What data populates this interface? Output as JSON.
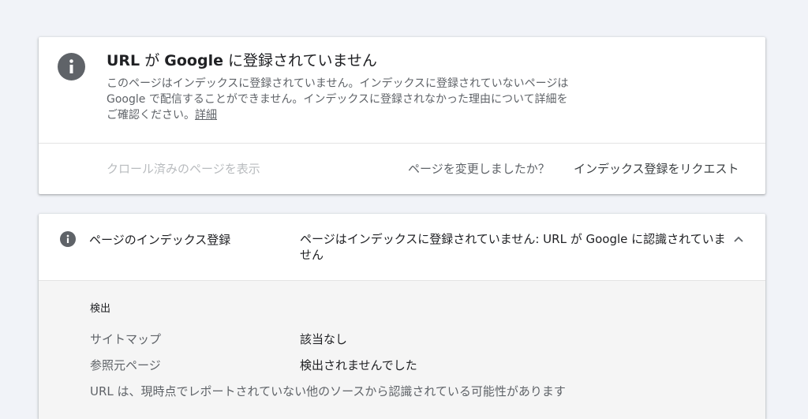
{
  "status_card": {
    "icon": "info-icon",
    "title": {
      "url": "URL",
      "ga": " が ",
      "google": "Google",
      "rest": " に登録されていません"
    },
    "description": "このページはインデックスに登録されていません。インデックスに登録されていないページは Google で配信することができません。インデックスに登録されなかった理由について詳細をご確認ください。",
    "details_link": "詳細",
    "crawl_link": "クロール済みのページを表示",
    "question": "ページを変更しましたか？",
    "request_button": "インデックス登録をリクエスト"
  },
  "coverage_card": {
    "icon": "info-icon",
    "label": "ページのインデックス登録",
    "status": "ページはインデックスに登録されていません: URL が Google に認識されていません",
    "expanded": true,
    "section_title": "検出",
    "rows": [
      {
        "label": "サイトマップ",
        "value": "該当なし"
      },
      {
        "label": "参照元ページ",
        "value": "検出されませんでした"
      }
    ],
    "note": "URL は、現時点でレポートされていない他のソースから認識されている可能性があります"
  },
  "colors": {
    "background": "#f1f3f8",
    "icon_gray": "#5f6368",
    "text_primary": "#202124",
    "text_secondary": "#5f6368",
    "text_disabled": "#b9bcbf"
  }
}
